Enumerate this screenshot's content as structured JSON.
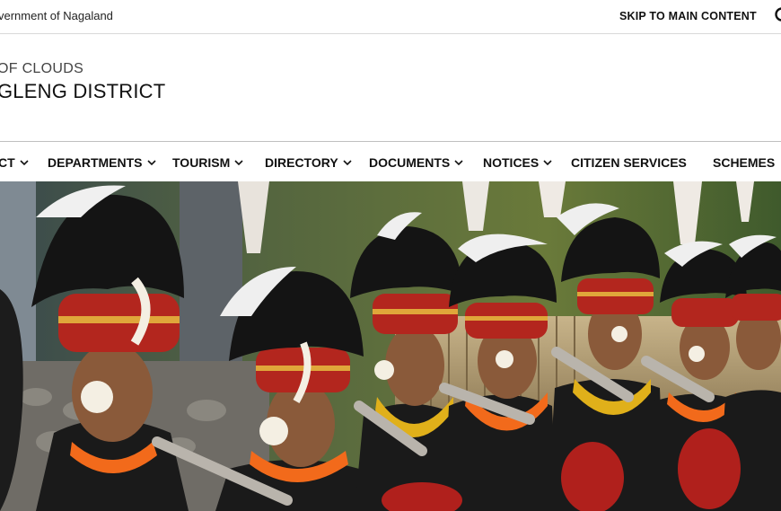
{
  "topbar": {
    "government_link": "vernment of Nagaland",
    "skip_link": "SKIP TO MAIN CONTENT",
    "search_icon": "search-icon"
  },
  "header": {
    "tagline": "OF CLOUDS",
    "district_name": "GLENG DISTRICT"
  },
  "nav": {
    "items": [
      {
        "label": "CT",
        "has_dropdown": true
      },
      {
        "label": "DEPARTMENTS",
        "has_dropdown": true
      },
      {
        "label": "TOURISM",
        "has_dropdown": true
      },
      {
        "label": "DIRECTORY",
        "has_dropdown": true
      },
      {
        "label": "DOCUMENTS",
        "has_dropdown": true
      },
      {
        "label": "NOTICES",
        "has_dropdown": true
      },
      {
        "label": "CITIZEN SERVICES",
        "has_dropdown": false
      },
      {
        "label": "SCHEMES",
        "has_dropdown": false
      }
    ],
    "dropdown_icon": "chevron-down-icon"
  },
  "hero": {
    "subject_colors": {
      "headdress_black": "#141414",
      "headband_red": "#b3261e",
      "necklace_orange": "#f26a1b",
      "skin": "#8a5a3a",
      "background_green": "#4f6b32"
    }
  }
}
